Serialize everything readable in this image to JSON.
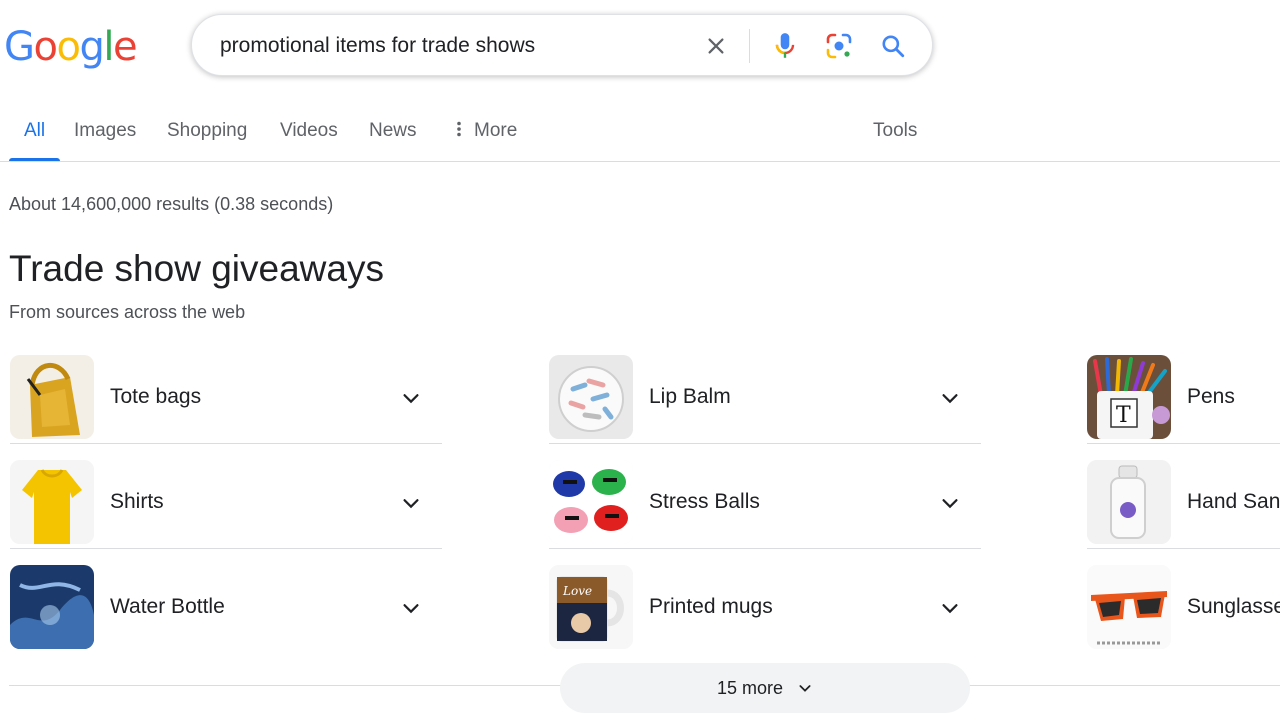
{
  "logo": {
    "letters": [
      "G",
      "o",
      "o",
      "g",
      "l",
      "e"
    ],
    "colors": [
      "#4285F4",
      "#EA4335",
      "#FBBC05",
      "#4285F4",
      "#34A853",
      "#EA4335"
    ]
  },
  "search": {
    "query": "promotional items for trade shows"
  },
  "tabs": [
    {
      "label": "All"
    },
    {
      "label": "Images"
    },
    {
      "label": "Shopping"
    },
    {
      "label": "Videos"
    },
    {
      "label": "News"
    },
    {
      "label": "More"
    },
    {
      "label": "Tools"
    }
  ],
  "stats": "About 14,600,000 results (0.38 seconds)",
  "section": {
    "title": "Trade show giveaways",
    "subtitle": "From sources across the web"
  },
  "items": [
    {
      "label": "Tote bags",
      "icon": "tote-bag-thumbnail"
    },
    {
      "label": "Shirts",
      "icon": "shirt-thumbnail"
    },
    {
      "label": "Water Bottle",
      "icon": "water-bottle-thumbnail"
    },
    {
      "label": "Lip Balm",
      "icon": "lip-balm-thumbnail"
    },
    {
      "label": "Stress Balls",
      "icon": "stress-balls-thumbnail"
    },
    {
      "label": "Printed mugs",
      "icon": "printed-mug-thumbnail"
    },
    {
      "label": "Pens",
      "icon": "pens-thumbnail"
    },
    {
      "label": "Hand San",
      "icon": "hand-sanitizer-thumbnail"
    },
    {
      "label": "Sunglasse",
      "icon": "sunglasses-thumbnail"
    }
  ],
  "more_button": {
    "label": "15 more"
  },
  "mug_text": "Love",
  "colors": {
    "accent": "#1a73e8",
    "muted": "#5f6368",
    "border": "#dadce0"
  }
}
